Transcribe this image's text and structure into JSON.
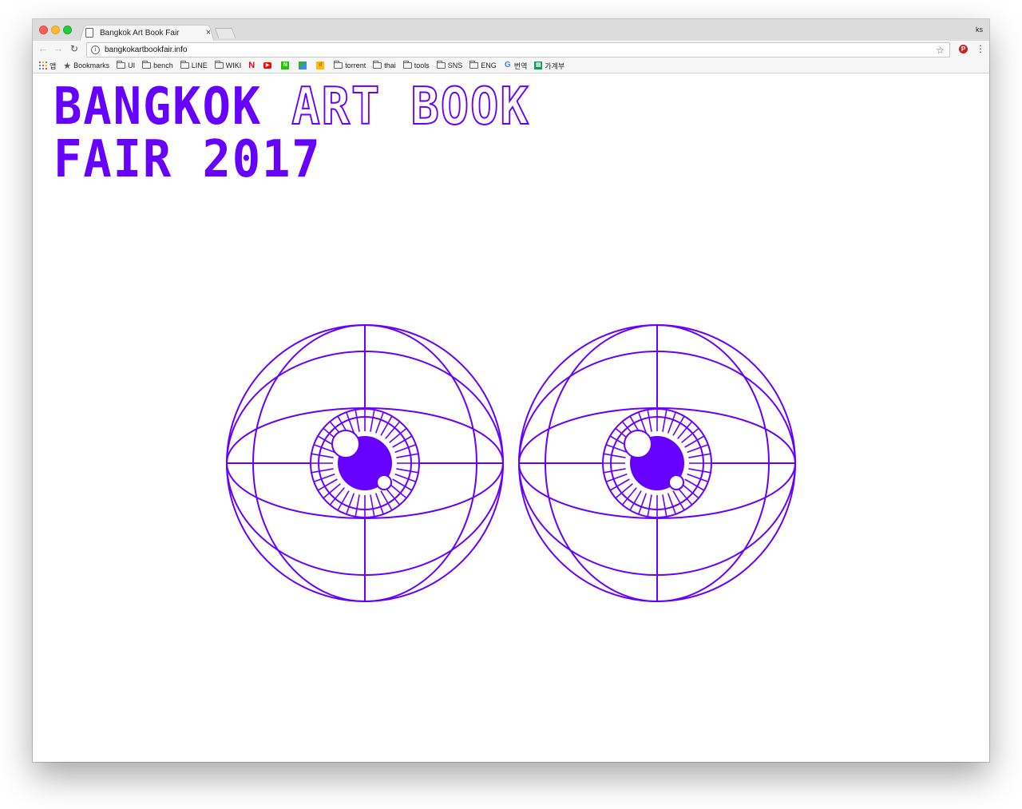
{
  "browser": {
    "tab_title": "Bangkok Art Book Fair",
    "tab_close": "×",
    "profile": "ks",
    "url": "bangkokartbookfair.info"
  },
  "bookmarks": [
    {
      "label": "앱",
      "icon": "apps-grid-icon"
    },
    {
      "label": "Bookmarks",
      "icon": "star-icon"
    },
    {
      "label": "UI",
      "icon": "folder-icon"
    },
    {
      "label": "bench",
      "icon": "folder-icon"
    },
    {
      "label": "LINE",
      "icon": "folder-icon"
    },
    {
      "label": "WIKI",
      "icon": "folder-icon"
    },
    {
      "label": "",
      "icon": "netflix-icon"
    },
    {
      "label": "",
      "icon": "youtube-icon"
    },
    {
      "label": "",
      "icon": "naver-icon"
    },
    {
      "label": "",
      "icon": "maps-icon"
    },
    {
      "label": "",
      "icon": "analytics-icon"
    },
    {
      "label": "torrent",
      "icon": "folder-icon"
    },
    {
      "label": "thai",
      "icon": "folder-icon"
    },
    {
      "label": "tools",
      "icon": "folder-icon"
    },
    {
      "label": "SNS",
      "icon": "folder-icon"
    },
    {
      "label": "ENG",
      "icon": "folder-icon"
    },
    {
      "label": "번역",
      "icon": "google-icon"
    },
    {
      "label": "가계부",
      "icon": "sheets-icon"
    }
  ],
  "page": {
    "headline_word1": "BANGKOK",
    "headline_word2": "ART",
    "headline_word3": "BOOK",
    "headline_line2": "FAIR 2017",
    "accent_color": "#6600ff"
  }
}
